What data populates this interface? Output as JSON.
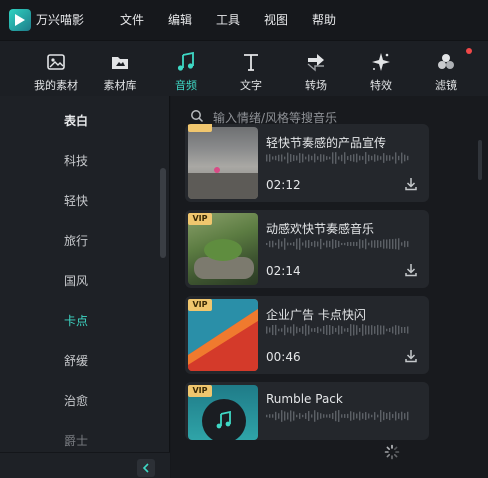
{
  "app": {
    "title": "万兴喵影"
  },
  "menu": [
    "文件",
    "编辑",
    "工具",
    "视图",
    "帮助"
  ],
  "toolbar": {
    "items": [
      {
        "label": "我的素材",
        "icon": "my-media-icon"
      },
      {
        "label": "素材库",
        "icon": "stock-library-icon"
      },
      {
        "label": "音频",
        "icon": "music-note-icon",
        "active": true
      },
      {
        "label": "文字",
        "icon": "text-icon"
      },
      {
        "label": "转场",
        "icon": "transition-icon"
      },
      {
        "label": "特效",
        "icon": "effects-icon"
      },
      {
        "label": "滤镜",
        "icon": "filters-icon",
        "notification": true
      }
    ]
  },
  "sidebar": {
    "categories": [
      {
        "label": "表白"
      },
      {
        "label": "科技"
      },
      {
        "label": "轻快"
      },
      {
        "label": "旅行"
      },
      {
        "label": "国风"
      },
      {
        "label": "卡点",
        "active": true
      },
      {
        "label": "舒缓"
      },
      {
        "label": "治愈"
      },
      {
        "label": "爵士"
      }
    ]
  },
  "search": {
    "placeholder": "输入情绪/风格等搜音乐"
  },
  "tracks": [
    {
      "title": "轻快节奏感的产品宣传",
      "duration": "02:12",
      "vip": true
    },
    {
      "title": "动感欢快节奏感音乐",
      "duration": "02:14",
      "vip": true,
      "badge": "VIP"
    },
    {
      "title": "企业广告 卡点快闪",
      "duration": "00:46",
      "vip": true,
      "badge": "VIP"
    },
    {
      "title": "Rumble Pack",
      "duration": "",
      "vip": true,
      "badge": "VIP"
    }
  ],
  "colors": {
    "accent": "#3ed8c5",
    "vip": "#f0c66e",
    "notification": "#f04848"
  }
}
